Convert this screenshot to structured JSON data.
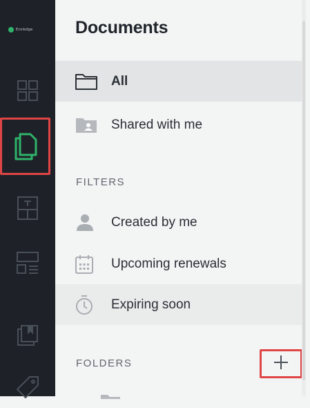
{
  "app": {
    "logo_text": "Ecoledge"
  },
  "rail": {
    "items": [
      {
        "name": "dashboard",
        "icon": "grid-icon",
        "active": false
      },
      {
        "name": "documents",
        "icon": "documents-icon",
        "active": true
      },
      {
        "name": "templates",
        "icon": "template-icon",
        "active": false
      },
      {
        "name": "layouts",
        "icon": "layout-icon",
        "active": false
      },
      {
        "name": "library",
        "icon": "library-icon",
        "active": false
      },
      {
        "name": "tags",
        "icon": "tag-icon",
        "active": false
      }
    ],
    "active_color": "#2fb36a",
    "inactive_color": "#4a5058"
  },
  "panel": {
    "title": "Documents",
    "nav": [
      {
        "label": "All",
        "icon": "folder-icon",
        "selected": true
      },
      {
        "label": "Shared with me",
        "icon": "shared-folder-icon",
        "selected": false
      }
    ],
    "filters_heading": "FILTERS",
    "filters": [
      {
        "label": "Created by me",
        "icon": "person-icon"
      },
      {
        "label": "Upcoming renewals",
        "icon": "calendar-icon"
      },
      {
        "label": "Expiring soon",
        "icon": "timer-icon"
      }
    ],
    "folders_heading": "FOLDERS",
    "add_folder_icon": "plus-icon"
  },
  "colors": {
    "highlight_border": "#e04545",
    "rail_bg": "#1e2228",
    "panel_bg": "#f3f4f4"
  }
}
